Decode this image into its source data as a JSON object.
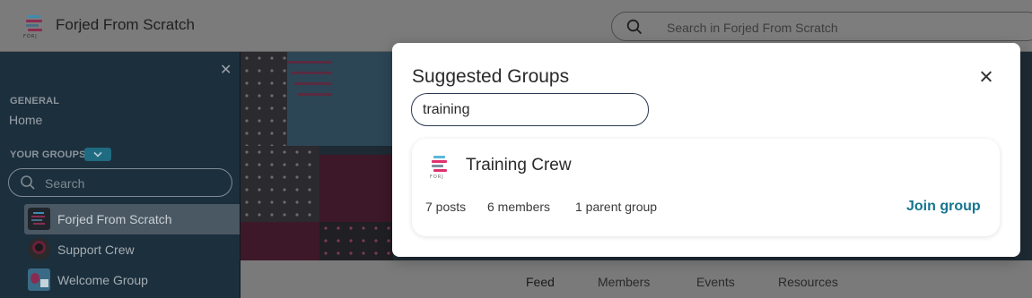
{
  "header": {
    "app_title": "Forjed From Scratch",
    "logo_text": "FORJ",
    "search_placeholder": "Search in Forjed From Scratch",
    "search_icon": "search-icon"
  },
  "sidebar": {
    "close_icon": "close-icon",
    "general_label": "GENERAL",
    "home_label": "Home",
    "your_groups_label": "YOUR GROUPS",
    "search_placeholder": "Search",
    "groups": [
      {
        "label": "Forjed From Scratch",
        "active": true
      },
      {
        "label": "Support Crew",
        "active": false
      },
      {
        "label": "Welcome Group",
        "active": false
      }
    ]
  },
  "tabs": [
    "Feed",
    "Members",
    "Events",
    "Resources"
  ],
  "modal": {
    "title": "Suggested Groups",
    "search_value": "training",
    "close_icon": "close-icon",
    "result": {
      "name": "Training Crew",
      "logo_text": "FORJ",
      "posts": "7 posts",
      "members": "6 members",
      "parent": "1 parent group",
      "join_label": "Join group"
    }
  },
  "colors": {
    "accent": "#16748e",
    "logo_pink": "#e0306f",
    "logo_blue": "#5bb8d8",
    "logo_navy": "#2b3a52"
  }
}
